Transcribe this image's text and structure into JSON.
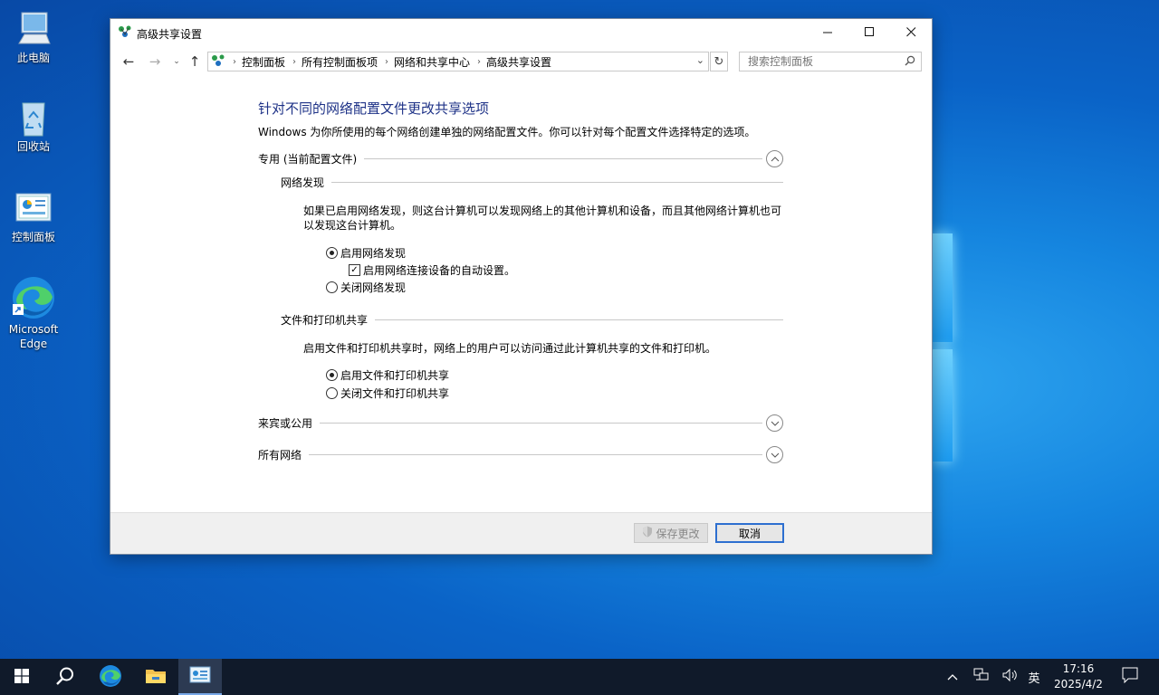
{
  "desktop": {
    "icons": [
      {
        "label": "此电脑"
      },
      {
        "label": "回收站"
      },
      {
        "label": "控制面板"
      },
      {
        "label": "Microsoft Edge"
      }
    ]
  },
  "window": {
    "title": "高级共享设置",
    "controls": {
      "minimize": "minimize-icon",
      "maximize": "maximize-icon",
      "close": "close-icon"
    },
    "breadcrumb": [
      "控制面板",
      "所有控制面板项",
      "网络和共享中心",
      "高级共享设置"
    ],
    "search_placeholder": "搜索控制面板",
    "heading": "针对不同的网络配置文件更改共享选项",
    "description": "Windows 为你所使用的每个网络创建单独的网络配置文件。你可以针对每个配置文件选择特定的选项。",
    "private_profile": {
      "title": "专用 (当前配置文件)",
      "discovery": {
        "title": "网络发现",
        "text": "如果已启用网络发现，则这台计算机可以发现网络上的其他计算机和设备，而且其他网络计算机也可以发现这台计算机。",
        "on": "启用网络发现",
        "auto": "启用网络连接设备的自动设置。",
        "off": "关闭网络发现"
      },
      "sharing": {
        "title": "文件和打印机共享",
        "text": "启用文件和打印机共享时，网络上的用户可以访问通过此计算机共享的文件和打印机。",
        "on": "启用文件和打印机共享",
        "off": "关闭文件和打印机共享"
      }
    },
    "guest_profile": {
      "title": "来宾或公用"
    },
    "all_profile": {
      "title": "所有网络"
    },
    "buttons": {
      "save": "保存更改",
      "cancel": "取消"
    }
  },
  "taskbar": {
    "ime": "英",
    "time": "17:16",
    "date": "2025/4/2"
  }
}
